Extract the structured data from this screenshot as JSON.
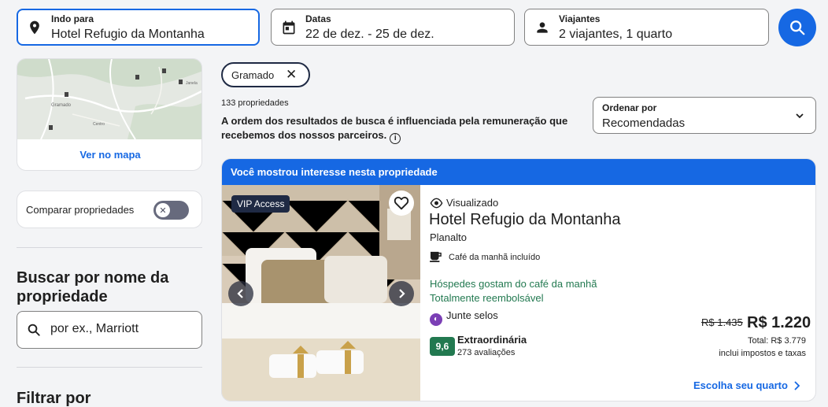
{
  "search": {
    "destination": {
      "label": "Indo para",
      "value": "Hotel Refugio da Montanha"
    },
    "dates": {
      "label": "Datas",
      "value": "22 de dez. - 25 de dez."
    },
    "travelers": {
      "label": "Viajantes",
      "value": "2 viajantes, 1 quarto"
    }
  },
  "sidebar": {
    "map_link": "Ver no mapa",
    "compare_label": "Comparar propriedades",
    "compare_enabled": false,
    "name_search_title": "Buscar por nome da propriedade",
    "name_search_placeholder": "por ex., Marriott",
    "filter_title": "Filtrar por",
    "map_labels": [
      "Gramado",
      "Janela",
      "Centro"
    ]
  },
  "results": {
    "chip": "Gramado",
    "count": "133 propriedades",
    "disclaimer": "A ordem dos resultados de busca é influenciada pela remuneração que recebemos dos nossos parceiros.",
    "sort": {
      "label": "Ordenar por",
      "value": "Recomendadas"
    }
  },
  "card": {
    "banner": "Você mostrou interesse nesta propriedade",
    "vip_badge": "VIP Access",
    "viewed": "Visualizado",
    "name": "Hotel Refugio da Montanha",
    "location": "Planalto",
    "amenity": "Café da manhã incluído",
    "highlight1": "Hóspedes gostam do café da manhã",
    "highlight2": "Totalmente reembolsável",
    "rewards": "Junte selos",
    "score": "9,6",
    "rating_label": "Extraordinária",
    "reviews": "273 avaliações",
    "old_price": "R$ 1.435",
    "price": "R$ 1.220",
    "total": "Total: R$ 3.779",
    "taxes": "inclui impostos e taxas",
    "cta": "Escolha seu quarto"
  },
  "colors": {
    "accent": "#1668e3",
    "rating_green": "#227950",
    "vip": "#1f2a44",
    "rewards_purple": "#7b3fb5"
  }
}
